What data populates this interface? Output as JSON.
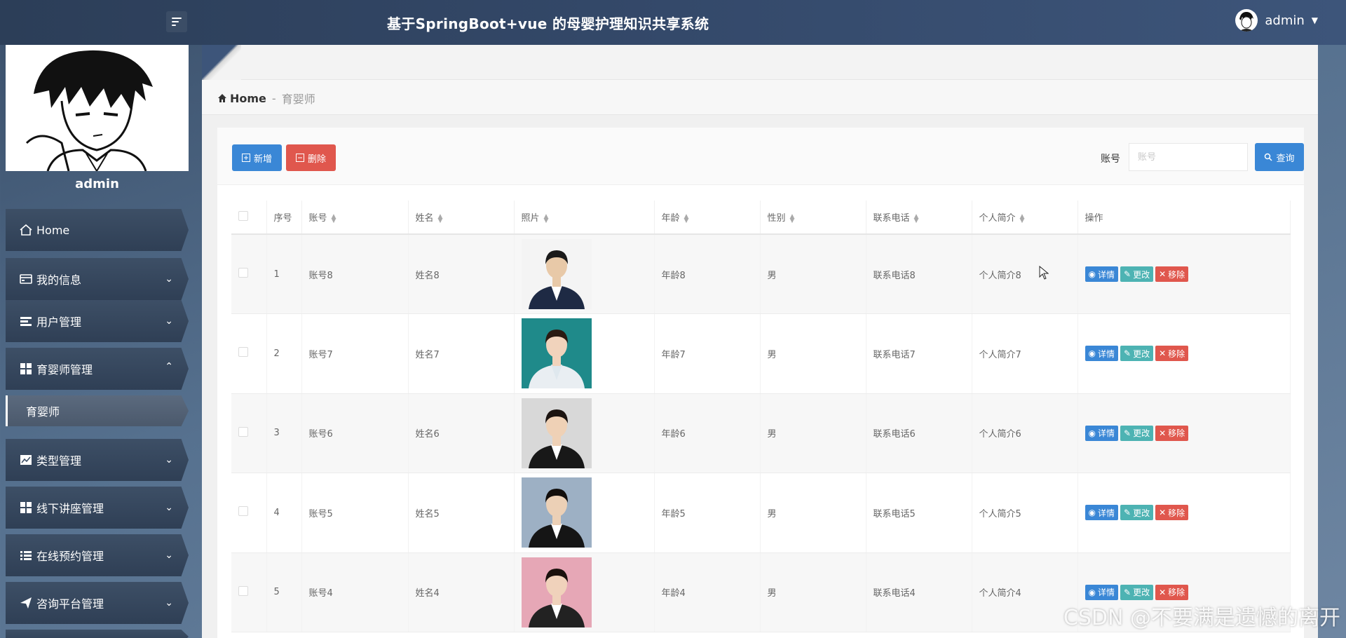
{
  "header": {
    "title": "基于SpringBoot+vue 的母婴护理知识共享系统",
    "user": "admin"
  },
  "sidebar": {
    "profile_name": "admin",
    "items": [
      {
        "label": "Home"
      },
      {
        "label": "我的信息"
      },
      {
        "label": "用户管理"
      },
      {
        "label": "育婴师管理"
      },
      {
        "label": "类型管理"
      },
      {
        "label": "线下讲座管理"
      },
      {
        "label": "在线预约管理"
      },
      {
        "label": "咨询平台管理"
      }
    ],
    "active_sub": "育婴师"
  },
  "breadcrumb": {
    "home": "Home",
    "sep": "-",
    "current": "育婴师"
  },
  "toolbar": {
    "add_label": "新增",
    "delete_label": "删除",
    "search_label": "账号",
    "search_placeholder": "账号",
    "query_label": "查询"
  },
  "table": {
    "columns": [
      "序号",
      "账号",
      "姓名",
      "照片",
      "年龄",
      "性别",
      "联系电话",
      "个人简介",
      "操作"
    ],
    "rows": [
      {
        "no": "1",
        "account": "账号8",
        "name": "姓名8",
        "age": "年龄8",
        "gender": "男",
        "phone": "联系电话8",
        "intro": "个人简介8"
      },
      {
        "no": "2",
        "account": "账号7",
        "name": "姓名7",
        "age": "年龄7",
        "gender": "男",
        "phone": "联系电话7",
        "intro": "个人简介7"
      },
      {
        "no": "3",
        "account": "账号6",
        "name": "姓名6",
        "age": "年龄6",
        "gender": "男",
        "phone": "联系电话6",
        "intro": "个人简介6"
      },
      {
        "no": "4",
        "account": "账号5",
        "name": "姓名5",
        "age": "年龄5",
        "gender": "男",
        "phone": "联系电话5",
        "intro": "个人简介5"
      },
      {
        "no": "5",
        "account": "账号4",
        "name": "姓名4",
        "age": "年龄4",
        "gender": "男",
        "phone": "联系电话4",
        "intro": "个人简介4"
      }
    ],
    "ops": {
      "detail": "详情",
      "edit": "更改",
      "remove": "移除"
    }
  },
  "watermark": "CSDN @不要满是遗憾的离开",
  "colors": {
    "primary": "#3a87d6",
    "danger": "#e0574d",
    "teal": "#4db3b3",
    "topbar": "#2c3e58"
  }
}
